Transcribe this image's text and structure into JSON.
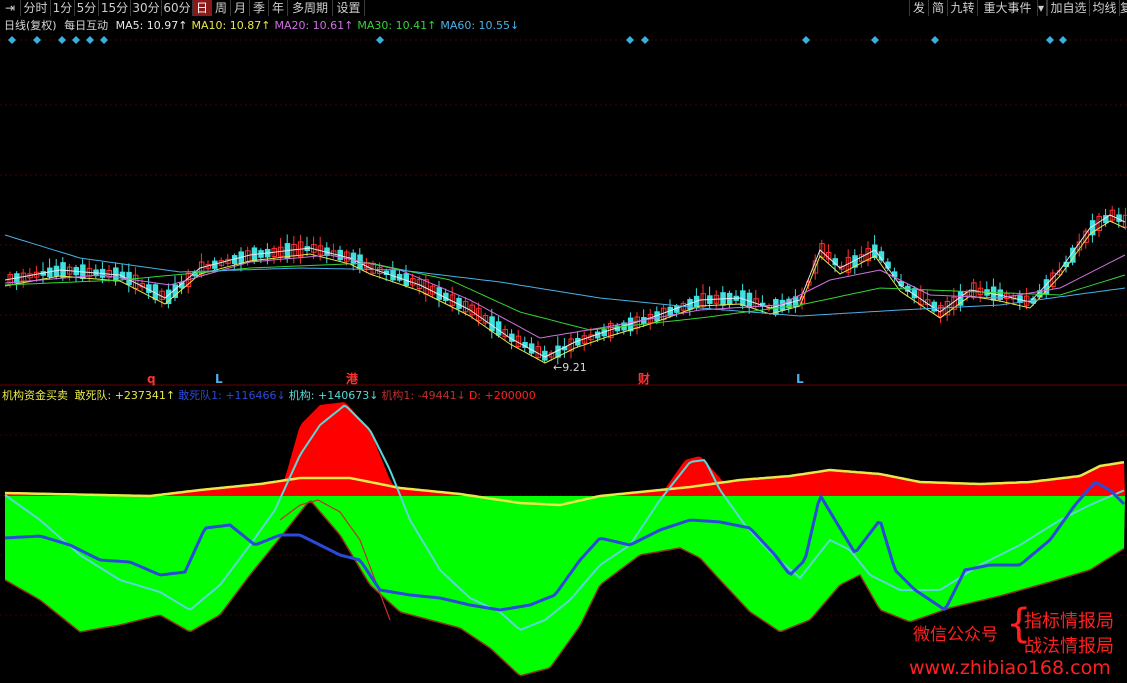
{
  "toolbar": {
    "left_items": [
      "分时",
      "1分",
      "5分",
      "15分",
      "30分",
      "60分",
      "日",
      "周",
      "月",
      "季",
      "年",
      "多周期",
      "设置"
    ],
    "active_item": "日",
    "right_items": [
      "发",
      "简",
      "九转",
      "重大事件",
      "加自选",
      "均线",
      "复"
    ]
  },
  "price_panel": {
    "title": "日线(复权)",
    "stock_name": "每日互动",
    "ma": [
      {
        "label": "MA5: 10.97↑",
        "color": "#e8e8e8"
      },
      {
        "label": "MA10: 10.87↑",
        "color": "#e8e84a"
      },
      {
        "label": "MA20: 10.61↑",
        "color": "#d070e0"
      },
      {
        "label": "MA30: 10.41↑",
        "color": "#36d436"
      },
      {
        "label": "MA60: 10.55↓",
        "color": "#4ab0e8"
      }
    ],
    "low_annotation": "←9.21",
    "markers": [
      {
        "text": "q",
        "color": "#ff3030"
      },
      {
        "text": "L",
        "color": "#4ab0e8"
      },
      {
        "text": "港",
        "color": "#ff3030"
      },
      {
        "text": "财",
        "color": "#ff3030"
      },
      {
        "text": "L",
        "color": "#4ab0e8"
      }
    ]
  },
  "indicator_panel": {
    "name": "机构资金买卖",
    "legend": [
      {
        "label": "敢死队: +237341↑",
        "color": "#e8e84a"
      },
      {
        "label": "敢死队1: +116466↓",
        "color": "#2a4ad8"
      },
      {
        "label": "机构: +140673↓",
        "color": "#5ad8d8"
      },
      {
        "label": "机构1: -49441↓",
        "color": "#c03030"
      },
      {
        "label": "D: +200000",
        "color": "#ff2020"
      }
    ]
  },
  "watermark": {
    "wechat": "微信公众号",
    "line1": "指标情报局",
    "line2": "战法情报局",
    "url": "www.zhibiao168.com"
  },
  "colors": {
    "bullish": "#ff3030",
    "bearish": "#40e0e0",
    "fill_red": "#ff0000",
    "fill_green": "#00ff00"
  },
  "chart_data": {
    "type": "line",
    "description_series": [
      {
        "name": "敢死队",
        "values": [
          237341
        ]
      },
      {
        "name": "敢死队1",
        "values": [
          116466
        ]
      },
      {
        "name": "机构",
        "values": [
          140673
        ]
      },
      {
        "name": "机构1",
        "values": [
          -49441
        ]
      },
      {
        "name": "D",
        "values": [
          200000
        ]
      }
    ],
    "ma_values": {
      "MA5": 10.97,
      "MA10": 10.87,
      "MA20": 10.61,
      "MA30": 10.41,
      "MA60": 10.55
    },
    "period_low": 9.21
  }
}
